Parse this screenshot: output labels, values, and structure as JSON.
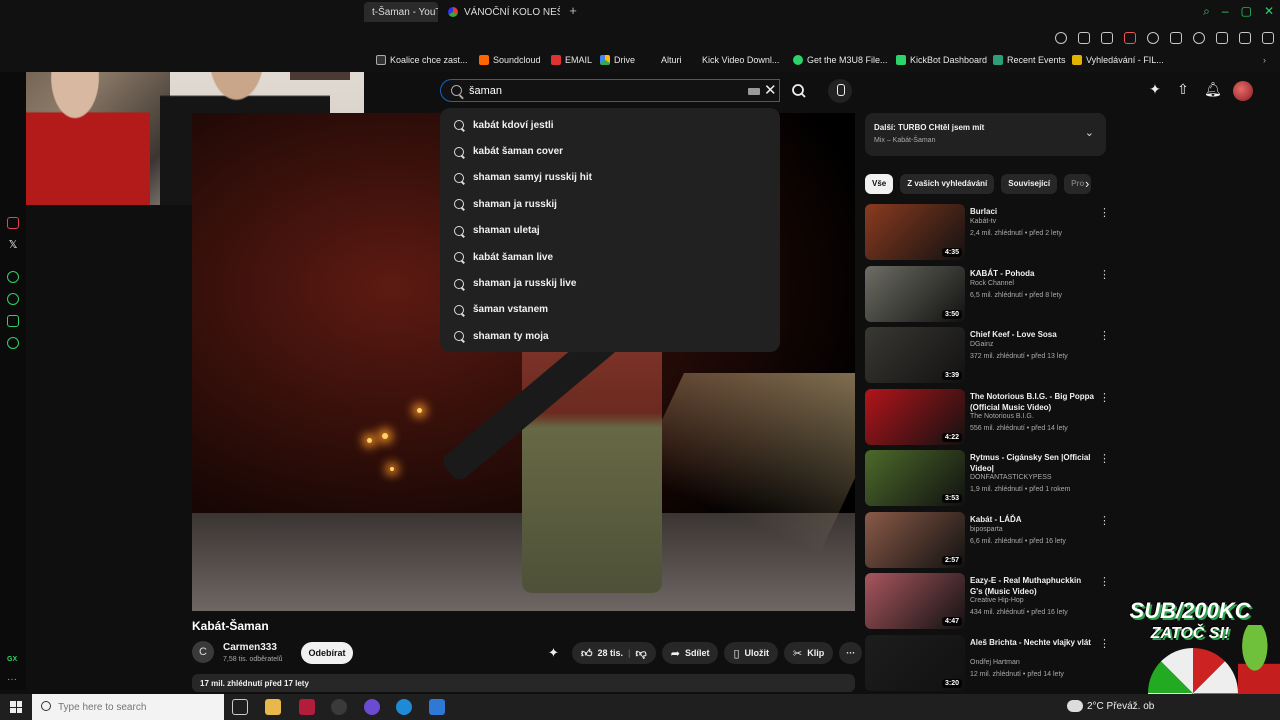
{
  "browser": {
    "tabs": [
      {
        "label": "t-Šaman - YouTube",
        "active": true
      },
      {
        "label": "VÁNOČNÍ KOLO NEŠTĚSTÍ",
        "active": false
      }
    ],
    "bookmarks": [
      {
        "label": "Koalice chce zast...",
        "icon": "h-icon"
      },
      {
        "label": "Soundcloud",
        "icon": "soundcloud-icon"
      },
      {
        "label": "EMAIL",
        "icon": "gmail-icon"
      },
      {
        "label": "Drive",
        "icon": "drive-icon"
      },
      {
        "label": "Alturi",
        "icon": "folder-icon"
      },
      {
        "label": "Kick Video Downl...",
        "icon": "dot-icon"
      },
      {
        "label": "Get the M3U8 File...",
        "icon": "green-circle-icon"
      },
      {
        "label": "KickBot Dashboard",
        "icon": "kickbot-icon"
      },
      {
        "label": "Recent Events",
        "icon": "events-icon"
      },
      {
        "label": "Vyhledávání - FIL...",
        "icon": "search-folder-icon"
      }
    ]
  },
  "youtube": {
    "search": {
      "value": "šaman"
    },
    "suggestions": [
      "kabát kdoví jestli",
      "kabát šaman cover",
      "shaman samyj russkij hit",
      "shaman ja russkij",
      "shaman uletaj",
      "kabát šaman live",
      "shaman ja russkij live",
      "šaman vstanem",
      "shaman ty moja"
    ],
    "video": {
      "title": "Kabát-Šaman",
      "channel_initial": "C",
      "channel": "Carmen333",
      "subscribers": "7,58 tis. odběratelů",
      "subscribe_label": "Odebírat",
      "likes": "28 tis.",
      "share_label": "Sdílet",
      "save_label": "Uložit",
      "clip_label": "Klip",
      "description_meta": "17 mil. zhlédnutí  před 17 lety"
    },
    "playlist": {
      "title": "Další: TURBO CHtěl jsem mít",
      "subtitle": "Mix – Kabát-Šaman"
    },
    "chips": [
      "Vše",
      "Z vašich vyhledávání",
      "Související",
      "Pro"
    ],
    "recommendations": [
      {
        "title": "Burlaci",
        "channel": "Kabát-tv",
        "meta": "2,4 mil. zhlédnutí • před 2 lety",
        "duration": "4:35",
        "color": "#8b3b1f"
      },
      {
        "title": "KABÁT - Pohoda",
        "channel": "Rock Channel",
        "meta": "6,5 mil. zhlédnutí • před 8 lety",
        "duration": "3:50",
        "color": "#6d6d64"
      },
      {
        "title": "Chief Keef - Love Sosa",
        "channel": "DGainz",
        "meta": "372 mil. zhlédnutí • před 13 lety",
        "duration": "3:39",
        "color": "#3a3833"
      },
      {
        "title": "The Notorious B.I.G. - Big Poppa (Official Music Video)",
        "channel": "The Notorious B.I.G.",
        "meta": "556 mil. zhlédnutí • před 14 lety",
        "duration": "4:22",
        "color": "#b3141a"
      },
      {
        "title": "Rytmus - Cigánsky Sen |Official Video|",
        "channel": "DONFANTASTICKYPESS",
        "meta": "1,9 mil. zhlédnutí • před 1 rokem",
        "duration": "3:53",
        "color": "#4c6a2a"
      },
      {
        "title": "Kabát - LÁĎA",
        "channel": "biposparta",
        "meta": "6,6 mil. zhlédnutí • před 16 lety",
        "duration": "2:57",
        "color": "#8a5a48"
      },
      {
        "title": "Eazy-E - Real Muthaphuckkin G's (Music Video)",
        "channel": "Creative Hip-Hop",
        "meta": "434 mil. zhlédnutí • před 16 lety",
        "duration": "4:47",
        "color": "#a8565e"
      },
      {
        "title": "Aleš Brichta - Nechte vlajky vlát",
        "channel": "Ondřej Hartman",
        "meta": "12 mil. zhlédnutí • před 14 lety",
        "duration": "3:20",
        "color": "#1d1d1d"
      }
    ]
  },
  "overlay": {
    "line1": "SUB/200KC",
    "line2": "ZATOČ SI!"
  },
  "taskbar": {
    "search_placeholder": "Type here to search",
    "weather": "2°C  Převáž. ob"
  }
}
